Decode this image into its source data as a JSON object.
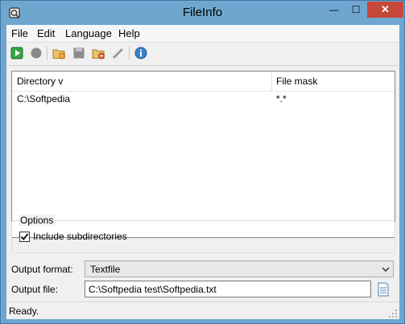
{
  "window": {
    "title": "FileInfo"
  },
  "titlebar_buttons": {
    "minimize": "—",
    "maximize": "☐",
    "close": "✕"
  },
  "menu": [
    "File",
    "Edit",
    "Language",
    "Help"
  ],
  "toolbar": {
    "icons": [
      "start-icon",
      "stop-icon",
      "add-folder-icon",
      "save-icon",
      "remove-folder-icon",
      "edit-icon",
      "about-icon"
    ]
  },
  "list": {
    "columns": [
      "Directory  v",
      "File mask"
    ],
    "rows": [
      {
        "directory": "C:\\Softpedia",
        "mask": "*.*"
      }
    ]
  },
  "options": {
    "legend": "Options",
    "include_subdirectories": {
      "label": "Include subdirectories",
      "checked": true
    }
  },
  "output": {
    "format_label": "Output format:",
    "format_value": "Textfile",
    "file_label": "Output file:",
    "file_value": "C:\\Softpedia test\\Softpedia.txt"
  },
  "status": "Ready."
}
